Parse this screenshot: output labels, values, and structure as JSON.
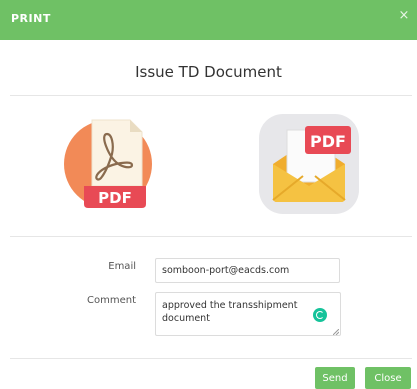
{
  "dialog": {
    "header_title": "PRINT",
    "close_glyph": "×",
    "title": "Issue TD Document"
  },
  "icons": {
    "pdf_file": {
      "name": "pdf-file-icon",
      "text": "PDF"
    },
    "pdf_email": {
      "name": "pdf-email-icon",
      "text": "PDF"
    }
  },
  "form": {
    "email_label": "Email",
    "email_value": "somboon-port@eacds.com",
    "comment_label": "Comment",
    "comment_value": "approved the transshipment document"
  },
  "footer": {
    "send_label": "Send",
    "close_label": "Close"
  },
  "colors": {
    "accent": "#6fc165",
    "pdf_red": "#e84a55",
    "adobe_orange": "#f28a57",
    "envelope_yellow": "#f5c242",
    "grammarly": "#15c39a"
  }
}
